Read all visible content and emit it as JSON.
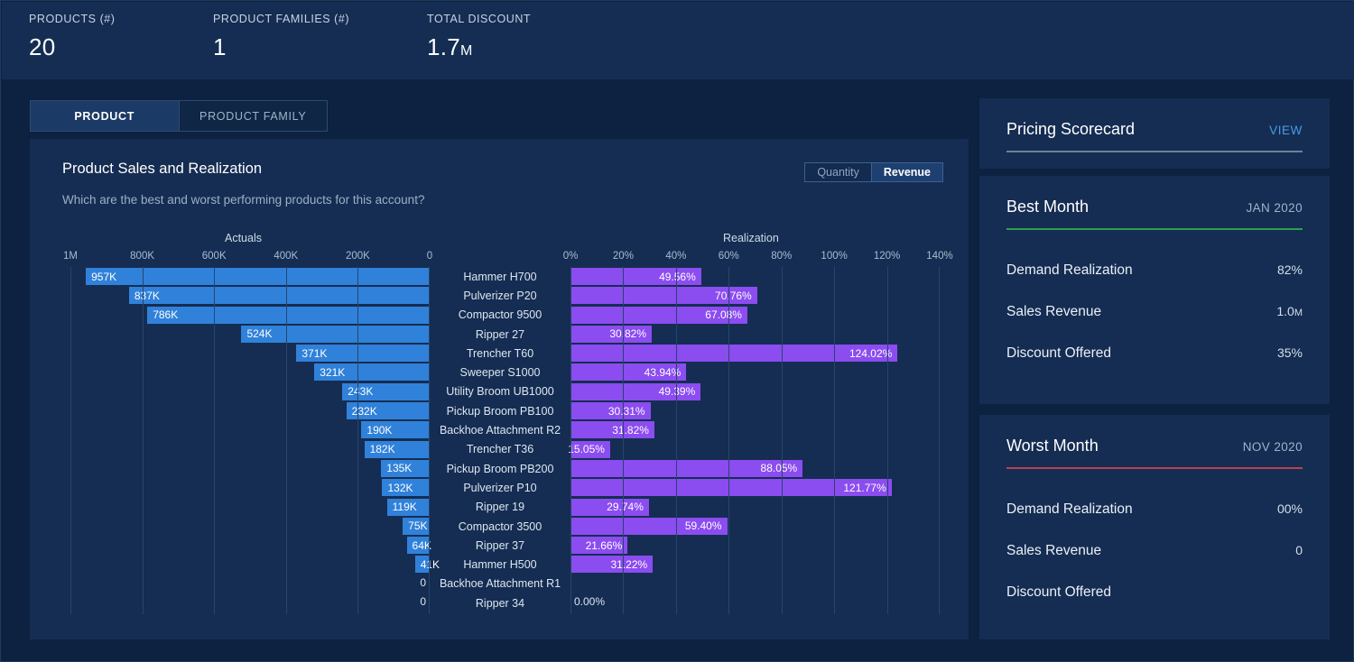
{
  "kpis": [
    {
      "label": "PRODUCTS (#)",
      "value": "20"
    },
    {
      "label": "PRODUCT FAMILIES (#)",
      "value": "1"
    },
    {
      "label": "TOTAL DISCOUNT",
      "value": "1.7",
      "unit": "M"
    }
  ],
  "tabs": [
    {
      "label": "PRODUCT",
      "active": true
    },
    {
      "label": "PRODUCT FAMILY",
      "active": false
    }
  ],
  "chart_card": {
    "title": "Product Sales and Realization",
    "subtitle": "Which are the best and worst performing products for this account?",
    "toggle": [
      {
        "label": "Quantity",
        "active": false
      },
      {
        "label": "Revenue",
        "active": true
      }
    ]
  },
  "chart_data": {
    "type": "bar",
    "orientation": "horizontal",
    "layout": "butterfly",
    "title": "Product Sales and Realization",
    "subtitle": "Which are the best and worst performing products for this account?",
    "grid": true,
    "categories": [
      "Hammer H700",
      "Pulverizer P20",
      "Compactor 9500",
      "Ripper 27",
      "Trencher T60",
      "Sweeper S1000",
      "Utility Broom UB1000",
      "Pickup Broom PB100",
      "Backhoe Attachment R2",
      "Trencher T36",
      "Pickup Broom PB200",
      "Pulverizer P10",
      "Ripper 19",
      "Compactor 3500",
      "Ripper 37",
      "Hammer H500",
      "Backhoe Attachment R1",
      "Ripper 34"
    ],
    "series": [
      {
        "name": "Actuals",
        "axis": "left",
        "direction": "right-to-left",
        "color": "#3081da",
        "xlabel": "Actuals",
        "tick_labels": [
          "1M",
          "800K",
          "600K",
          "400K",
          "200K",
          "0"
        ],
        "tick_values": [
          1000000,
          800000,
          600000,
          400000,
          200000,
          0
        ],
        "xlim": [
          1000000,
          0
        ],
        "values": [
          957000,
          837000,
          786000,
          524000,
          371000,
          321000,
          243000,
          232000,
          190000,
          182000,
          135000,
          132000,
          119000,
          75000,
          64000,
          41000,
          0,
          0
        ],
        "value_labels": [
          "957K",
          "837K",
          "786K",
          "524K",
          "371K",
          "321K",
          "243K",
          "232K",
          "190K",
          "182K",
          "135K",
          "132K",
          "119K",
          "75K",
          "64K",
          "41K",
          "0",
          "0"
        ]
      },
      {
        "name": "Realization",
        "axis": "right",
        "direction": "left-to-right",
        "color": "#8b4cf0",
        "xlabel": "Realization",
        "tick_labels": [
          "0%",
          "20%",
          "40%",
          "60%",
          "80%",
          "100%",
          "120%",
          "140%"
        ],
        "tick_values": [
          0,
          20,
          40,
          60,
          80,
          100,
          120,
          140
        ],
        "xlim": [
          0,
          140
        ],
        "values": [
          49.56,
          70.76,
          67.08,
          30.82,
          124.02,
          43.94,
          49.39,
          30.31,
          31.82,
          15.05,
          88.05,
          121.77,
          29.74,
          59.4,
          21.66,
          31.22,
          null,
          0.0
        ],
        "value_labels": [
          "49.56%",
          "70.76%",
          "67.08%",
          "30.82%",
          "124.02%",
          "43.94%",
          "49.39%",
          "30.31%",
          "31.82%",
          "15.05%",
          "88.05%",
          "121.77%",
          "29.74%",
          "59.40%",
          "21.66%",
          "31.22%",
          "",
          "0.00%"
        ]
      }
    ]
  },
  "sidebar": {
    "scorecard": {
      "title": "Pricing Scorecard",
      "link": "VIEW"
    },
    "best_month": {
      "title": "Best Month",
      "period": "JAN 2020",
      "metrics": [
        {
          "label": "Demand Realization",
          "value": "82%",
          "unit": ""
        },
        {
          "label": "Sales Revenue",
          "value": "1.0",
          "unit": "M"
        },
        {
          "label": "Discount Offered",
          "value": "35%",
          "unit": ""
        }
      ]
    },
    "worst_month": {
      "title": "Worst Month",
      "period": "NOV 2020",
      "metrics": [
        {
          "label": "Demand Realization",
          "value": "00%",
          "unit": ""
        },
        {
          "label": "Sales Revenue",
          "value": "0",
          "unit": ""
        },
        {
          "label": "Discount Offered",
          "value": "",
          "unit": ""
        }
      ]
    }
  },
  "colors": {
    "page_background": "#0d2240",
    "card_background": "#152d52",
    "actuals_bar": "#3081da",
    "realization_bar": "#8b4cf0",
    "link": "#4a9ae8",
    "best_rule": "#2e9e4f",
    "worst_rule": "#b7434a"
  }
}
